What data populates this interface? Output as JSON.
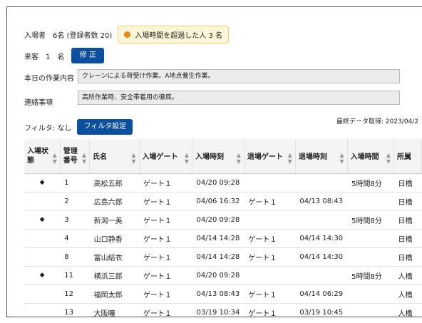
{
  "summary": {
    "attendees": "入場者　6名 (登録者数 20)",
    "alert_text": "入場時間を超過した人 3 名",
    "visitor_label": "来客　1　名",
    "edit_button": "修 正"
  },
  "work": {
    "content_label": "本日の作業内容",
    "content_value": "クレーンによる荷受け作業。A地点養生作業。",
    "notes_label": "連絡事項",
    "notes_value": "高所作業時、安全帯着用の徹底。"
  },
  "filter": {
    "label": "フィルタ: なし",
    "button": "フィルタ設定",
    "last_fetch": "最終データ取得: 2023/04/2"
  },
  "table": {
    "headers": [
      "入場状態",
      "管理番号",
      "氏名",
      "入場ゲート",
      "入場時刻",
      "退場ゲート",
      "退場時刻",
      "入場時間",
      "所属"
    ],
    "header_lines": [
      [
        "入場状",
        "態"
      ],
      [
        "管理",
        "番号"
      ]
    ],
    "sort_icon": "sort-updown",
    "rows": [
      {
        "status": "◆",
        "id": "1",
        "name": "高松五郎",
        "in_gate": "ゲート１",
        "in_time": "04/20 09:28",
        "out_gate": "",
        "out_time": "",
        "duration": "5時間8分",
        "org": "日橋"
      },
      {
        "status": "",
        "id": "2",
        "name": "広島六郎",
        "in_gate": "ゲート１",
        "in_time": "04/06 16:32",
        "out_gate": "ゲート１",
        "out_time": "04/13 08:43",
        "duration": "",
        "org": "日橋"
      },
      {
        "status": "◆",
        "id": "3",
        "name": "新潟一美",
        "in_gate": "ゲート１",
        "in_time": "04/20 09:28",
        "out_gate": "",
        "out_time": "",
        "duration": "5時間8分",
        "org": "日橋"
      },
      {
        "status": "",
        "id": "4",
        "name": "山口静香",
        "in_gate": "ゲート１",
        "in_time": "04/14 14:28",
        "out_gate": "ゲート１",
        "out_time": "04/14 14:30",
        "duration": "",
        "org": "日橋"
      },
      {
        "status": "",
        "id": "8",
        "name": "富山結衣",
        "in_gate": "ゲート１",
        "in_time": "04/14 14:28",
        "out_gate": "ゲート１",
        "out_time": "04/14 14:30",
        "duration": "",
        "org": "日橋"
      },
      {
        "status": "◆",
        "id": "11",
        "name": "横浜三郎",
        "in_gate": "ゲート１",
        "in_time": "04/20 09:28",
        "out_gate": "",
        "out_time": "",
        "duration": "5時間8分",
        "org": "人橋"
      },
      {
        "status": "",
        "id": "12",
        "name": "福岡太郎",
        "in_gate": "ゲート１",
        "in_time": "04/13 08:43",
        "out_gate": "ゲート１",
        "out_time": "04/14 06:29",
        "duration": "",
        "org": "人橋"
      },
      {
        "status": "",
        "id": "13",
        "name": "大阪瞳",
        "in_gate": "ゲート１",
        "in_time": "03/19 10:34",
        "out_gate": "ゲート１",
        "out_time": "03/19 10:45",
        "duration": "",
        "org": "人橋"
      }
    ]
  },
  "colors": {
    "accent": "#0b4f9e",
    "alert_bg": "#fff6d9",
    "alert_dot": "#e98a10"
  }
}
